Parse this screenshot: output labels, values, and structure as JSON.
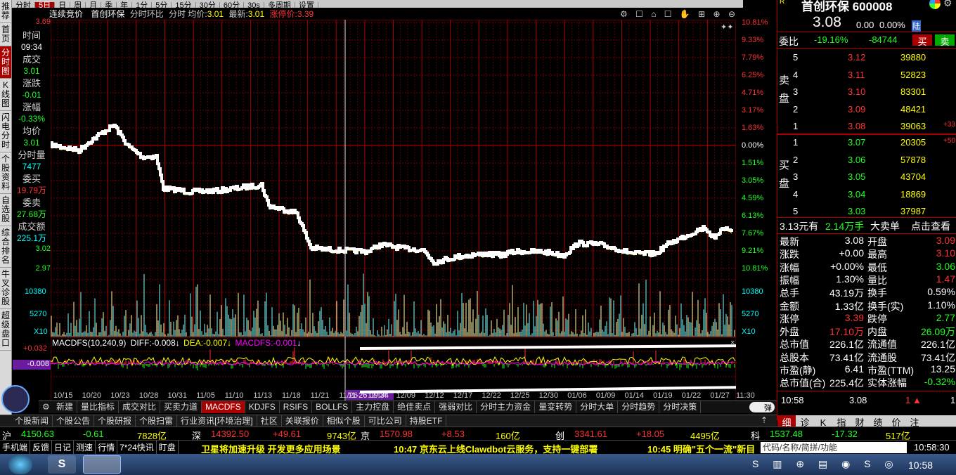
{
  "left_nav": [
    "推荐",
    "首页",
    "分时图",
    "K线图",
    "闪电分时",
    "个股资料",
    "自选股",
    "综合排名",
    "牛叉诊股",
    "超级盘口"
  ],
  "left_nav_active": 2,
  "toolbar": [
    "分时",
    "5日",
    "日",
    "周",
    "月",
    "季",
    "年",
    "1分",
    "5分",
    "15分",
    "30分",
    "60分",
    "30s",
    "多周期",
    "设置"
  ],
  "toolbar_selected": 1,
  "header": {
    "auction": "连续竞价",
    "name": "首创环保",
    "mode": "分时环比",
    "avg_label": "分时 均价:",
    "avg": "3.01",
    "last_label": "最新:",
    "last": "3.01",
    "limit_label": "涨停价:",
    "limit": "3.39"
  },
  "left_info": {
    "top_price": "3.69",
    "time_label": "时间",
    "time": "09:34",
    "vol_label": "成交",
    "vol": "3.01",
    "chg_label": "涨跌",
    "chg": "-0.01",
    "pct_label": "涨幅",
    "pct": "-0.33%",
    "avg_label": "均价",
    "avg": "3.01",
    "min_vol_label": "分时量",
    "min_vol": "7477",
    "bid_label": "委买",
    "bid": "19.79万",
    "ask_label": "委卖",
    "ask": "27.68万",
    "amt_label": "成交额",
    "amt": "225.1万",
    "p1": "3.02",
    "p2": "2.97"
  },
  "price_axis": [
    "10.81%",
    "9.33%",
    "7.79%",
    "6.25%",
    "4.71%",
    "3.17%",
    "1.63%",
    "0.00%",
    "1.51%",
    "3.05%",
    "4.59%",
    "6.13%",
    "7.67%",
    "9.21%",
    "10.81%"
  ],
  "vol_axis": {
    "left": [
      "10380",
      "5270",
      "X10"
    ],
    "right": [
      "10380",
      "5270",
      "X10"
    ]
  },
  "macd": {
    "title": "MACDFS(10,240,9)",
    "diff_label": "DIFF:",
    "diff": "-0.008",
    "dea_label": "DEA:",
    "dea": "-0.007",
    "macdfs_label": "MACDFS:",
    "macdfs": "-0.001",
    "left_top": "+0.032",
    "left_val": "-0.008"
  },
  "date_axis": [
    "10/15",
    "10/20",
    "10/23",
    "10/28",
    "10/31",
    "11/05",
    "11/10",
    "11/13",
    "11/18",
    "11/21",
    "11/26",
    "12/04",
    "12/09",
    "12/12",
    "12/17",
    "12/22",
    "12/25",
    "12/30",
    "01/06",
    "01/09",
    "01/14",
    "01/19",
    "01/22",
    "01/27"
  ],
  "cursor_label": "11-26 09:34",
  "end_time": "11:30",
  "bottom_tabs": [
    "新建",
    "量比指标",
    "成交对比",
    "买卖力道",
    "MACDFS",
    "KDJFS",
    "RSIFS",
    "BOLLFS",
    "主力控盘",
    "绝佳卖点",
    "强弱对比",
    "分时主力资金",
    "量变转势",
    "分时大单",
    "分时趋势",
    "分时决策"
  ],
  "bottom_tab_selected": 4,
  "bottom_right_button": "弹",
  "news_tabs": [
    "个股新闻",
    "个股公告",
    "个股研报",
    "个股扫雷",
    "行业资讯[环境治理]",
    "社区",
    "关联报价",
    "相似个股",
    "可比公司",
    "持股ETF"
  ],
  "stock": {
    "title": "首创环保 600008",
    "price": "3.08",
    "chg": "0.00",
    "pct": "0.00%",
    "tag": "陆",
    "ratio_label": "委比",
    "ratio": "-19.16%",
    "ratio_diff": "-84744",
    "buy_btn": "买",
    "sell_btn": "卖",
    "sell_label": "卖盘",
    "buy_label": "买盘",
    "sell": [
      {
        "n": "5",
        "p": "3.12",
        "v": "39880",
        "x": ""
      },
      {
        "n": "4",
        "p": "3.11",
        "v": "52823",
        "x": ""
      },
      {
        "n": "3",
        "p": "3.10",
        "v": "83301",
        "x": ""
      },
      {
        "n": "2",
        "p": "3.09",
        "v": "48421",
        "x": ""
      },
      {
        "n": "1",
        "p": "3.08",
        "v": "39063",
        "x": "+33"
      }
    ],
    "buy": [
      {
        "n": "1",
        "p": "3.07",
        "v": "20305",
        "x": "+50"
      },
      {
        "n": "2",
        "p": "3.06",
        "v": "57878",
        "x": ""
      },
      {
        "n": "3",
        "p": "3.05",
        "v": "43704",
        "x": ""
      },
      {
        "n": "4",
        "p": "3.04",
        "v": "18869",
        "x": ""
      },
      {
        "n": "5",
        "p": "3.03",
        "v": "37987",
        "x": ""
      }
    ],
    "big_order": {
      "a": "3.13元有",
      "b": "2.14万手",
      "c": "大卖单",
      "d": "点击查看"
    },
    "stats": [
      [
        "最新",
        "3.08",
        "开盘",
        "3.09"
      ],
      [
        "涨跌",
        "+0.00",
        "最高",
        "3.10"
      ],
      [
        "涨幅",
        "+0.00%",
        "最低",
        "3.06"
      ],
      [
        "振幅",
        "1.30%",
        "量比",
        "1.47"
      ],
      [
        "总手",
        "43.19万",
        "换手",
        "0.59%"
      ],
      [
        "金额",
        "1.33亿",
        "换手(实)",
        "1.10%"
      ],
      [
        "涨停",
        "3.39",
        "跌停",
        "2.77"
      ],
      [
        "外盘",
        "17.10万",
        "内盘",
        "26.09万"
      ],
      [
        "总市值",
        "226.1亿",
        "流通值",
        "226.1亿"
      ],
      [
        "总股本",
        "73.41亿",
        "流通股",
        "73.41亿"
      ],
      [
        "市盈(静)",
        "6.41",
        "市盈(TTM)",
        "13.25"
      ],
      [
        "总市值(合)",
        "225.4亿",
        "实体涨幅",
        "-0.32%"
      ]
    ],
    "tick_time": "10:58",
    "tick_price": "3.08",
    "tick_vol": "1",
    "tabs": [
      "细",
      "诊",
      "K",
      "指",
      "财",
      "绩",
      "价",
      "注"
    ]
  },
  "indices": [
    {
      "name": "沪",
      "val": "4150.63",
      "chg": "-0.61",
      "amt": "7828亿"
    },
    {
      "name": "深",
      "val": "14392.50",
      "chg": "+49.61",
      "amt": "9743亿"
    },
    {
      "name": "京",
      "val": "1570.98",
      "chg": "+8.53",
      "amt": "160亿"
    },
    {
      "name": "创",
      "val": "3341.61",
      "chg": "+18.05",
      "amt": "4495亿"
    },
    {
      "name": "科",
      "val": "1537.48",
      "chg": "-17.32",
      "amt": "517亿"
    }
  ],
  "ticker": {
    "items": [
      "手机端",
      "反馈",
      "日记",
      "测速",
      "行情",
      "7*24快讯",
      "盯盘"
    ],
    "news1": "卫星将加速升级 开发更多应用场景",
    "news2": "10:47 京东云上线Clawdbot云服务，支持一键部署",
    "news3": "10:45 明确\"五个一流\"新目",
    "search_placeholder": "代码/名称/简拼/功能",
    "clock": "10:58:30"
  },
  "taskbar_clock": "10:58",
  "colors": {
    "up": "#ff3333",
    "down": "#22ff22",
    "grid": "#8b0000",
    "accent": "#aa0000"
  }
}
